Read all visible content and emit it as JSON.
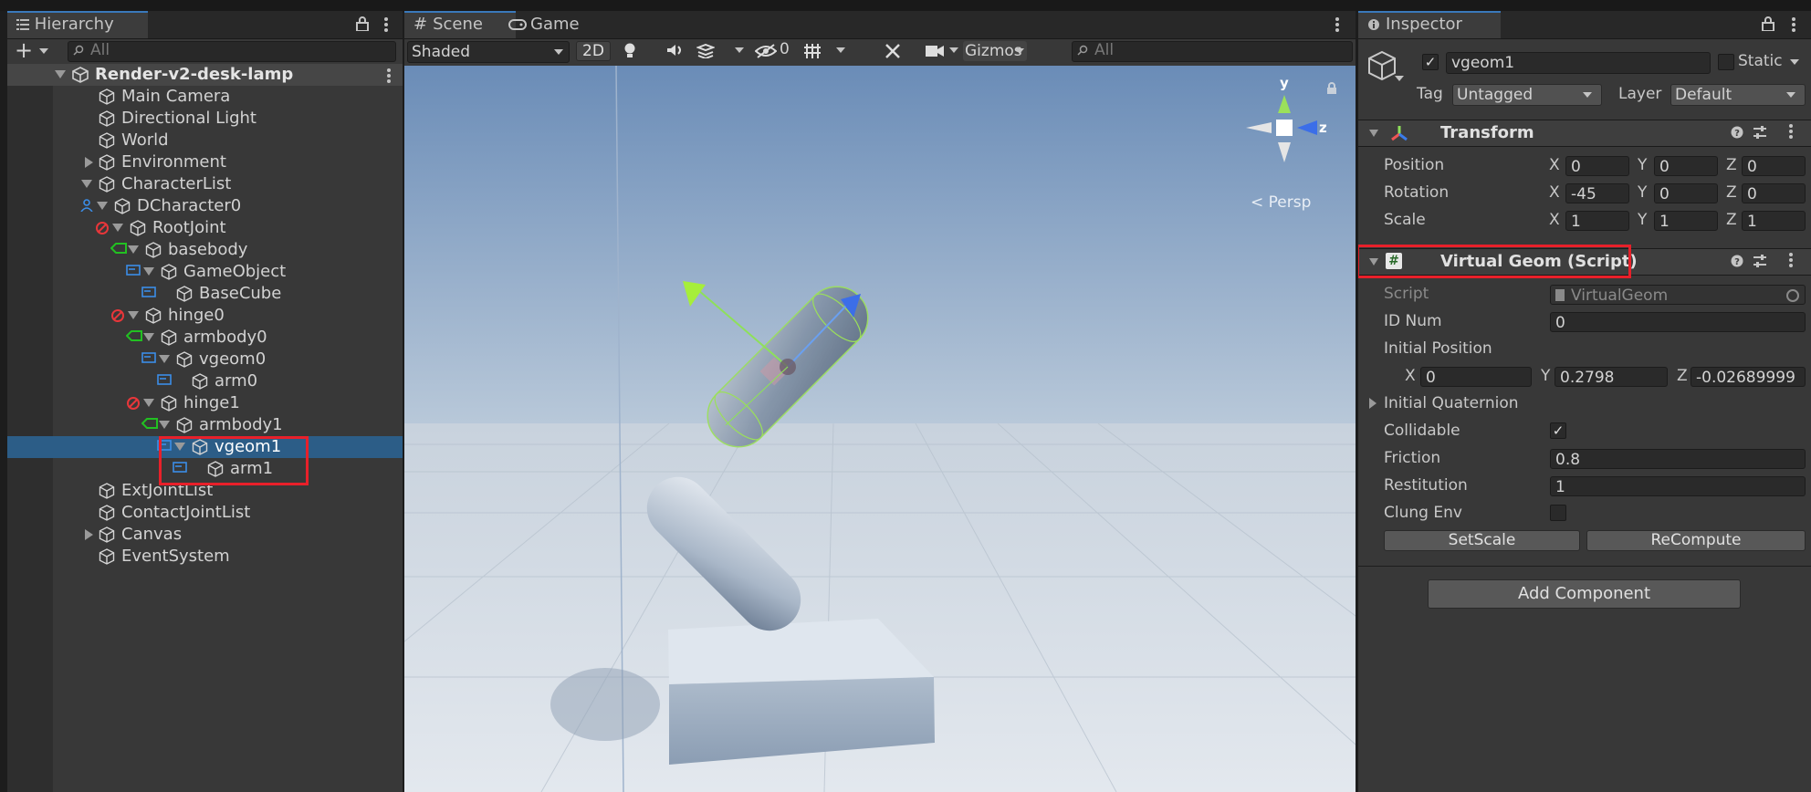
{
  "hierarchy": {
    "tab_label": "Hierarchy",
    "search_placeholder": "All",
    "scene_name": "Render-v2-desk-lamp",
    "items": [
      {
        "label": "Main Camera"
      },
      {
        "label": "Directional Light"
      },
      {
        "label": "World"
      },
      {
        "label": "Environment"
      },
      {
        "label": "CharacterList"
      },
      {
        "label": "DCharacter0"
      },
      {
        "label": "RootJoint"
      },
      {
        "label": "basebody"
      },
      {
        "label": "GameObject"
      },
      {
        "label": "BaseCube"
      },
      {
        "label": "hinge0"
      },
      {
        "label": "armbody0"
      },
      {
        "label": "vgeom0"
      },
      {
        "label": "arm0"
      },
      {
        "label": "hinge1"
      },
      {
        "label": "armbody1"
      },
      {
        "label": "vgeom1"
      },
      {
        "label": "arm1"
      },
      {
        "label": "ExtJointList"
      },
      {
        "label": "ContactJointList"
      },
      {
        "label": "Canvas"
      },
      {
        "label": "EventSystem"
      }
    ],
    "selected": "vgeom1"
  },
  "scene": {
    "tab_scene": "Scene",
    "tab_game": "Game",
    "draw_mode": "Shaded",
    "mode_2d": "2D",
    "hidden_count": "0",
    "gizmos_label": "Gizmos",
    "search_placeholder": "All",
    "gizmo_y": "y",
    "gizmo_z": "z",
    "persp_label": "< Persp"
  },
  "inspector": {
    "tab_label": "Inspector",
    "object_name": "vgeom1",
    "static_label": "Static",
    "tag_label": "Tag",
    "tag_value": "Untagged",
    "layer_label": "Layer",
    "layer_value": "Default",
    "transform": {
      "title": "Transform",
      "position_label": "Position",
      "rotation_label": "Rotation",
      "scale_label": "Scale",
      "position": {
        "x": "0",
        "y": "0",
        "z": "0"
      },
      "rotation": {
        "x": "-45",
        "y": "0",
        "z": "0"
      },
      "scale": {
        "x": "1",
        "y": "1",
        "z": "1"
      }
    },
    "vgeom": {
      "title": "Virtual Geom (Script)",
      "script_label": "Script",
      "script_value": "VirtualGeom",
      "id_label": "ID Num",
      "id_value": "0",
      "init_pos_label": "Initial Position",
      "init_pos": {
        "x": "0",
        "y": "0.2798",
        "z": "-0.02689999"
      },
      "init_quat_label": "Initial Quaternion",
      "collidable_label": "Collidable",
      "friction_label": "Friction",
      "friction_value": "0.8",
      "restitution_label": "Restitution",
      "restitution_value": "1",
      "clung_label": "Clung Env",
      "setscale_label": "SetScale",
      "recompute_label": "ReCompute"
    },
    "add_component_label": "Add Component",
    "axis": {
      "x": "X",
      "y": "Y",
      "z": "Z"
    }
  },
  "colors": {
    "selection": "#2c5d87",
    "highlight_box": "#e8202a",
    "sky_top": "#6d8eb8",
    "ground": "#dde3ea"
  }
}
